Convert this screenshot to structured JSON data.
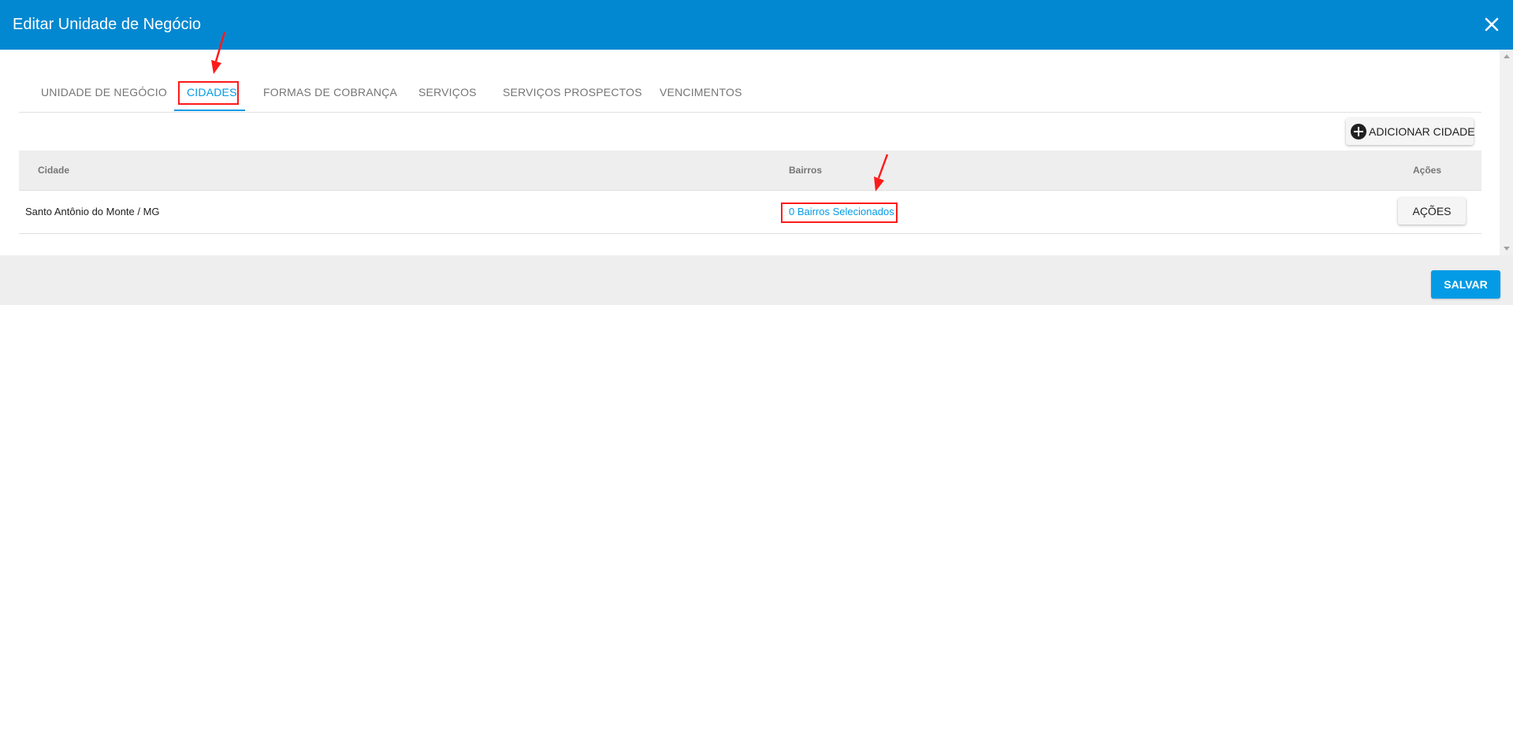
{
  "dialog": {
    "title": "Editar Unidade de Negócio",
    "close_icon": "close-icon"
  },
  "tabs": [
    {
      "label": "UNIDADE DE NEGÓCIO",
      "active": false
    },
    {
      "label": "CIDADES",
      "active": true
    },
    {
      "label": "FORMAS DE COBRANÇA",
      "active": false
    },
    {
      "label": "SERVIÇOS",
      "active": false
    },
    {
      "label": "SERVIÇOS PROSPECTOS",
      "active": false
    },
    {
      "label": "VENCIMENTOS",
      "active": false
    }
  ],
  "toolbar": {
    "add_city_label": "ADICIONAR CIDADE",
    "add_icon": "add-circle-icon"
  },
  "table": {
    "headers": {
      "city": "Cidade",
      "neighborhoods": "Bairros",
      "actions": "Ações"
    },
    "rows": [
      {
        "city": "Santo Antônio do Monte / MG",
        "neighborhoods_link": "0 Bairros Selecionados",
        "actions_label": "AÇÕES"
      }
    ]
  },
  "footer": {
    "save_label": "SALVAR"
  },
  "colors": {
    "primary": "#0288d1",
    "accent": "#039be5",
    "annotation": "#ff1a1a"
  }
}
